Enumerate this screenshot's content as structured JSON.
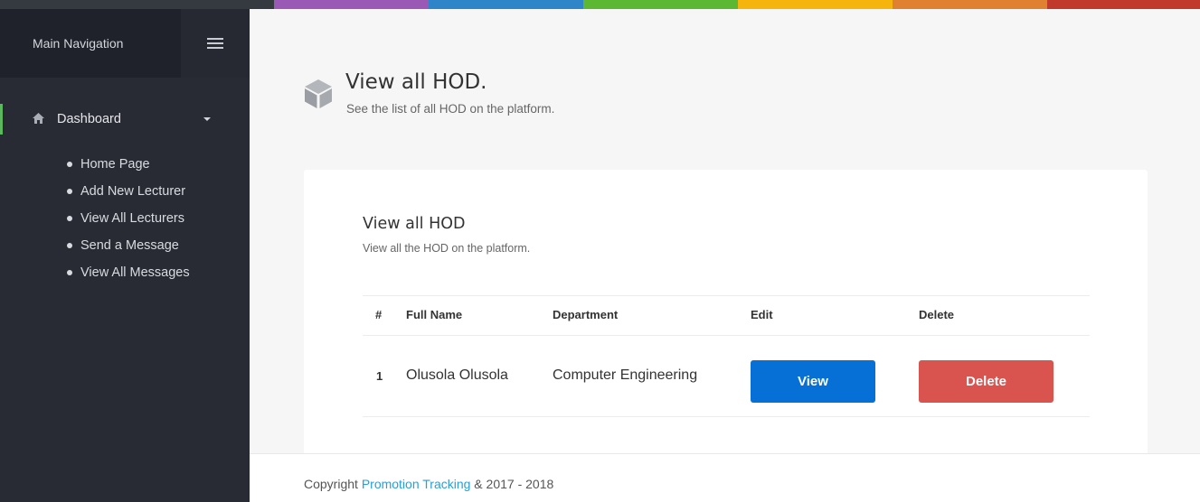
{
  "colors": {
    "top_bar": [
      "#343a40",
      "#9b59b6",
      "#2e86c9",
      "#5cb832",
      "#f5b50d",
      "#e08131",
      "#c0392b"
    ],
    "sidebar_bg": "#282b33",
    "accent_active": "#5cb85c",
    "view_button": "#0670d6",
    "delete_button": "#d9534f",
    "link": "#2a9fd6"
  },
  "sidebar": {
    "header_title": "Main Navigation",
    "menu_icon": "hamburger-icon",
    "dashboard": {
      "label": "Dashboard",
      "icon": "home-icon",
      "caret": "caret-down-icon"
    },
    "items": [
      {
        "label": "Home Page"
      },
      {
        "label": "Add New Lecturer"
      },
      {
        "label": "View All Lecturers"
      },
      {
        "label": "Send a Message"
      },
      {
        "label": "View All Messages"
      }
    ]
  },
  "page": {
    "icon": "cube-icon",
    "title": "View all HOD.",
    "subtitle": "See the list of all HOD on the platform."
  },
  "card": {
    "title": "View all HOD",
    "subtitle": "View all the HOD on the platform.",
    "columns": [
      "#",
      "Full Name",
      "Department",
      "Edit",
      "Delete"
    ],
    "rows": [
      {
        "index": "1",
        "full_name": "Olusola Olusola",
        "department": "Computer Engineering",
        "view_label": "View",
        "delete_label": "Delete"
      }
    ]
  },
  "footer": {
    "prefix": "Copyright ",
    "link": "Promotion Tracking",
    "suffix": " & 2017 - 2018"
  }
}
